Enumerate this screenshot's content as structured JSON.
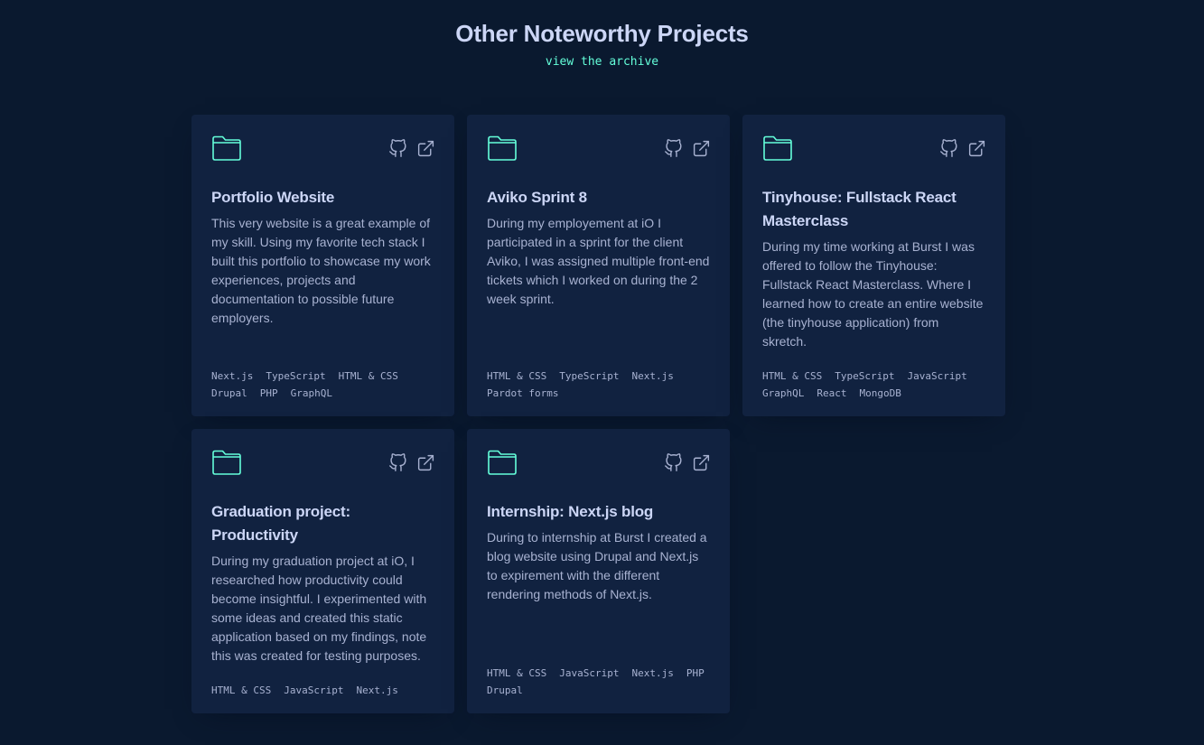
{
  "section": {
    "title": "Other Noteworthy Projects",
    "archive_link": "view the archive"
  },
  "colors": {
    "background": "#0a192f",
    "card": "#112240",
    "accent": "#64ffda",
    "heading": "#ccd6f6",
    "text": "#a8b2d1"
  },
  "icons": {
    "folder": "folder-icon",
    "github": "github-icon",
    "external": "external-link-icon"
  },
  "projects": [
    {
      "title": "Portfolio Website",
      "description": "This very website is a great example of my skill. Using my favorite tech stack I built this portfolio to showcase my work experiences, projects and documentation to possible future employers.",
      "tech": [
        "Next.js",
        "TypeScript",
        "HTML & CSS",
        "Drupal",
        "PHP",
        "GraphQL"
      ]
    },
    {
      "title": "Aviko Sprint 8",
      "description": "During my employement at iO I participated in a sprint for the client Aviko, I was assigned multiple front-end tickets which I worked on during the 2 week sprint.",
      "tech": [
        "HTML & CSS",
        "TypeScript",
        "Next.js",
        "Pardot forms"
      ]
    },
    {
      "title": "Tinyhouse: Fullstack React Masterclass",
      "description": "During my time working at Burst I was offered to follow the Tinyhouse: Fullstack React Masterclass. Where I learned how to create an entire website (the tinyhouse application) from skretch.",
      "tech": [
        "HTML & CSS",
        "TypeScript",
        "JavaScript",
        "GraphQL",
        "React",
        "MongoDB"
      ]
    },
    {
      "title": "Graduation project: Productivity",
      "description": "During my graduation project at iO, I researched how productivity could become insightful. I experimented with some ideas and created this static application based on my findings, note this was created for testing purposes.",
      "tech": [
        "HTML & CSS",
        "JavaScript",
        "Next.js"
      ]
    },
    {
      "title": "Internship: Next.js blog",
      "description": "During to internship at Burst I created a blog website using Drupal and Next.js to expirement with the different rendering methods of Next.js.",
      "tech": [
        "HTML & CSS",
        "JavaScript",
        "Next.js",
        "PHP",
        "Drupal"
      ]
    }
  ]
}
